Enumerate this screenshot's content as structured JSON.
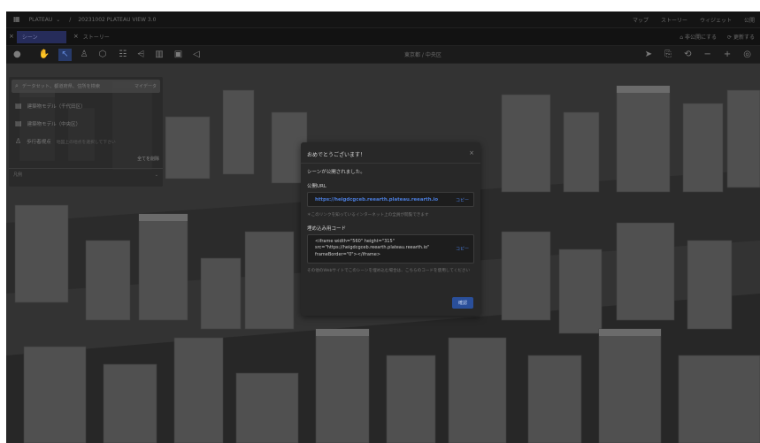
{
  "topbar": {
    "project_selector": "PLATEAU",
    "breadcrumb": "20231002 PLATEAU VIEW 3.0",
    "tabs": [
      "マップ",
      "ストーリー",
      "ウィジェット",
      "公開"
    ]
  },
  "tabbar": {
    "tab_scene": "シーン",
    "tab_story": "ストーリー",
    "unpublish": "非公開にする",
    "update": "更新する"
  },
  "toolbar": {
    "location": "東京都 / 中央区"
  },
  "panel": {
    "search_placeholder": "データセット、都道府県、住所を検索",
    "search_button": "マイデータ",
    "layers": [
      {
        "icon": "building-icon",
        "label": "建築物モデル（千代田区）"
      },
      {
        "icon": "building-icon",
        "label": "建築物モデル（中央区）"
      },
      {
        "icon": "pedestrian-icon",
        "label": "歩行者視点",
        "hint": "地図上の地点を選択して下さい"
      }
    ],
    "clear_all": "全てを削除",
    "footer_label": "凡例"
  },
  "modal": {
    "title": "おめでとうございます！",
    "message": "シーンが公開されました。",
    "url_label": "公開URL",
    "url": "https://heigdcgceb.reearth.plateau.reearth.io",
    "copy": "コピー",
    "url_note": "＊このリンクを知っているインターネット上の全員が閲覧できます",
    "embed_label": "埋め込み用コード",
    "embed_code": "<iframe width=\"560\" height=\"315\"\nsrc=\"https://heigdcgceb.reearth.plateau.reearth.io\"\nframeBorder=\"0\"></iframe>",
    "embed_note": "その他のWebサイトでこのシーンを埋め込む場合は、こちらのコードを使用してください",
    "ok": "確認"
  }
}
